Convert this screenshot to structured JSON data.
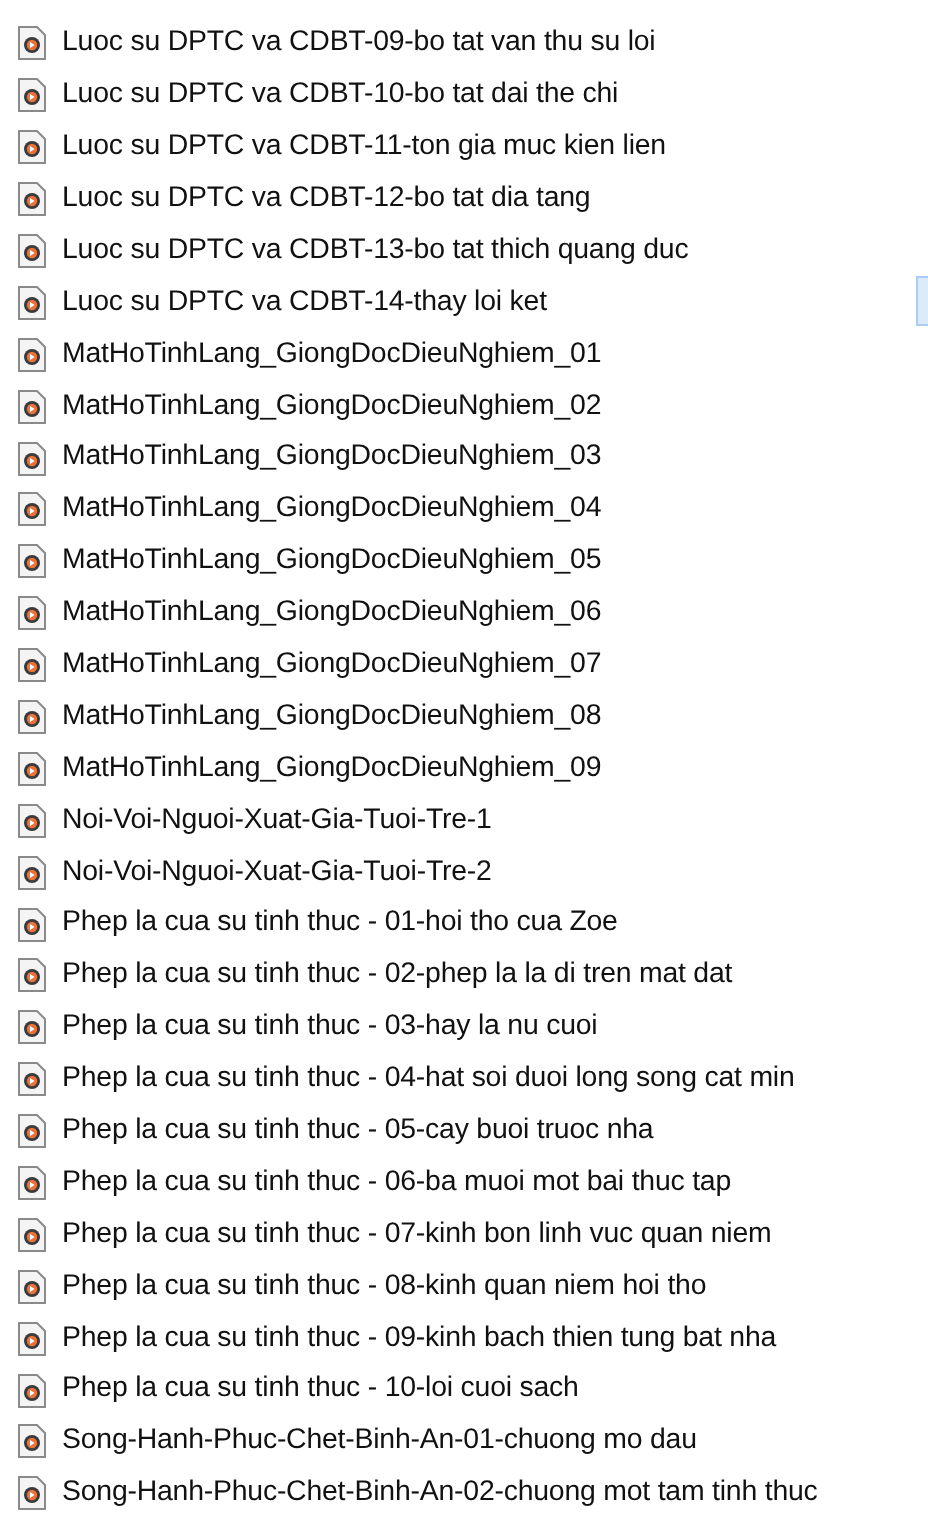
{
  "files": [
    {
      "name": "Luoc su DPTC va CDBT-09-bo tat van thu su loi"
    },
    {
      "name": "Luoc su DPTC va CDBT-10-bo tat dai the chi"
    },
    {
      "name": "Luoc su DPTC va CDBT-11-ton gia muc kien lien"
    },
    {
      "name": "Luoc su DPTC va CDBT-12-bo tat dia tang"
    },
    {
      "name": "Luoc su DPTC va CDBT-13-bo tat thich quang duc"
    },
    {
      "name": "Luoc su DPTC va CDBT-14-thay loi ket"
    },
    {
      "name": "MatHoTinhLang_GiongDocDieuNghiem_01"
    },
    {
      "name": "MatHoTinhLang_GiongDocDieuNghiem_02"
    },
    {
      "name": "MatHoTinhLang_GiongDocDieuNghiem_03"
    },
    {
      "name": "MatHoTinhLang_GiongDocDieuNghiem_04"
    },
    {
      "name": "MatHoTinhLang_GiongDocDieuNghiem_05"
    },
    {
      "name": "MatHoTinhLang_GiongDocDieuNghiem_06"
    },
    {
      "name": "MatHoTinhLang_GiongDocDieuNghiem_07"
    },
    {
      "name": "MatHoTinhLang_GiongDocDieuNghiem_08"
    },
    {
      "name": "MatHoTinhLang_GiongDocDieuNghiem_09"
    },
    {
      "name": "Noi-Voi-Nguoi-Xuat-Gia-Tuoi-Tre-1"
    },
    {
      "name": "Noi-Voi-Nguoi-Xuat-Gia-Tuoi-Tre-2"
    },
    {
      "name": "Phep la cua su tinh thuc - 01-hoi tho cua Zoe"
    },
    {
      "name": "Phep la cua su tinh thuc - 02-phep la la di tren mat dat"
    },
    {
      "name": "Phep la cua su tinh thuc - 03-hay la nu cuoi"
    },
    {
      "name": "Phep la cua su tinh thuc - 04-hat soi duoi long song cat min"
    },
    {
      "name": "Phep la cua su tinh thuc - 05-cay buoi truoc nha"
    },
    {
      "name": "Phep la cua su tinh thuc - 06-ba muoi mot bai thuc tap"
    },
    {
      "name": "Phep la cua su tinh thuc - 07-kinh bon linh vuc quan niem"
    },
    {
      "name": "Phep la cua su tinh thuc - 08-kinh quan niem hoi tho"
    },
    {
      "name": "Phep la cua su tinh thuc - 09-kinh bach thien tung bat nha"
    },
    {
      "name": "Phep la cua su tinh thuc - 10-loi cuoi sach"
    },
    {
      "name": "Song-Hanh-Phuc-Chet-Binh-An-01-chuong mo dau"
    },
    {
      "name": "Song-Hanh-Phuc-Chet-Binh-An-02-chuong mot tam tinh thuc"
    }
  ]
}
